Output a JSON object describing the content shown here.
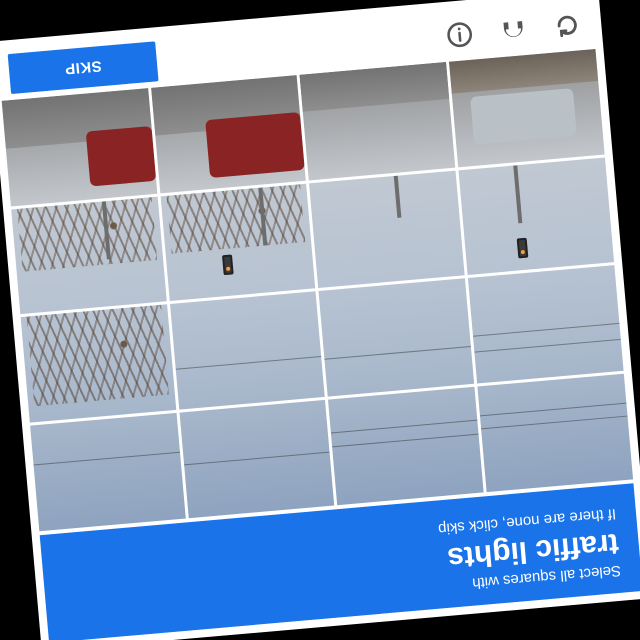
{
  "captcha": {
    "instruction_line1": "Select all squares with",
    "target": "traffic lights",
    "instruction_line3": "If there are none, click skip",
    "skip_label": "SKIP",
    "icons": [
      "reload-icon",
      "headphones-icon",
      "info-icon"
    ],
    "accent_color": "#1a73e8",
    "grid_rows": 4,
    "grid_cols": 4
  }
}
